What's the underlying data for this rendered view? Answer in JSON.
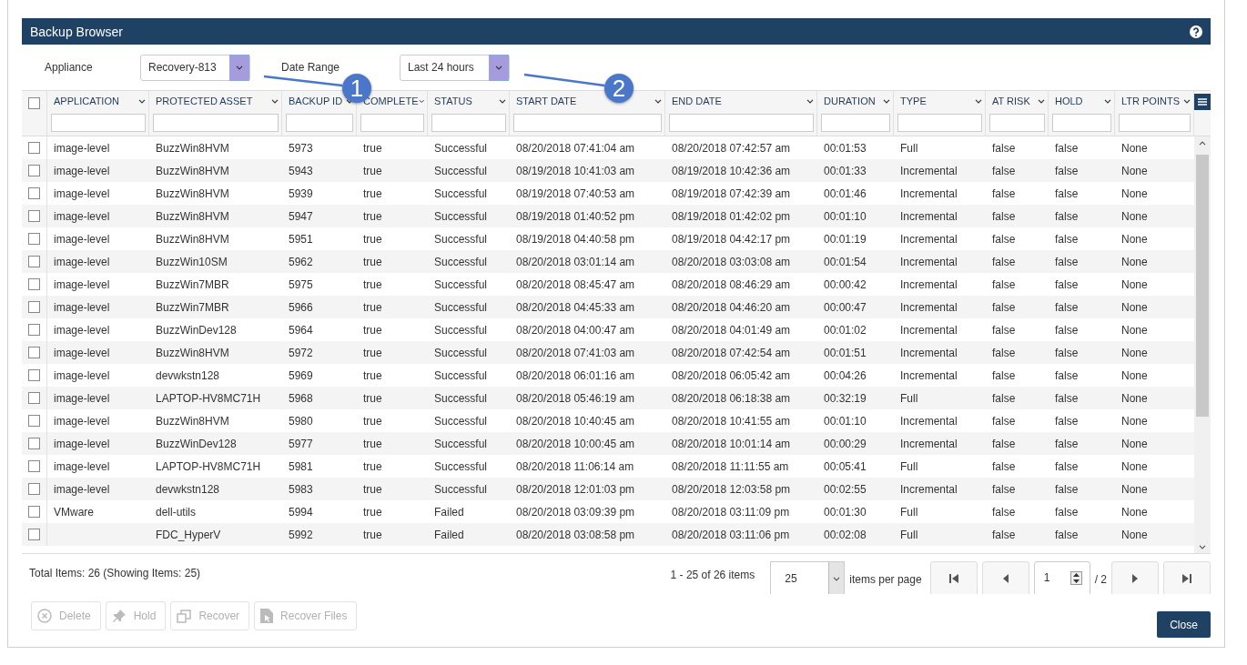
{
  "window": {
    "title": "Backup Browser"
  },
  "filters": [
    {
      "label": "Appliance",
      "value": "Recovery-813",
      "highlighted": true
    },
    {
      "label": "Date Range",
      "value": "Last 24 hours",
      "highlighted": true
    }
  ],
  "callouts": [
    "1",
    "2"
  ],
  "table": {
    "select_all": {
      "checked": false
    },
    "columns": [
      "APPLICATION",
      "PROTECTED ASSET",
      "BACKUP ID",
      "COMPLETE",
      "STATUS",
      "START DATE",
      "END DATE",
      "DURATION",
      "TYPE",
      "AT RISK",
      "HOLD",
      "LTR POINTS"
    ],
    "rows": [
      {
        "checked": false,
        "cells": [
          "image-level",
          "BuzzWin8HVM",
          "5973",
          "true",
          "Successful",
          "08/20/2018 07:41:04 am",
          "08/20/2018 07:42:57 am",
          "00:01:53",
          "Full",
          "false",
          "false",
          "None"
        ]
      },
      {
        "checked": false,
        "cells": [
          "image-level",
          "BuzzWin8HVM",
          "5943",
          "true",
          "Successful",
          "08/19/2018 10:41:03 am",
          "08/19/2018 10:42:36 am",
          "00:01:33",
          "Incremental",
          "false",
          "false",
          "None"
        ]
      },
      {
        "checked": false,
        "cells": [
          "image-level",
          "BuzzWin8HVM",
          "5939",
          "true",
          "Successful",
          "08/19/2018 07:40:53 am",
          "08/19/2018 07:42:39 am",
          "00:01:46",
          "Incremental",
          "false",
          "false",
          "None"
        ]
      },
      {
        "checked": false,
        "cells": [
          "image-level",
          "BuzzWin8HVM",
          "5947",
          "true",
          "Successful",
          "08/19/2018 01:40:52 pm",
          "08/19/2018 01:42:02 pm",
          "00:01:10",
          "Incremental",
          "false",
          "false",
          "None"
        ]
      },
      {
        "checked": false,
        "cells": [
          "image-level",
          "BuzzWin8HVM",
          "5951",
          "true",
          "Successful",
          "08/19/2018 04:40:58 pm",
          "08/19/2018 04:42:17 pm",
          "00:01:19",
          "Incremental",
          "false",
          "false",
          "None"
        ]
      },
      {
        "checked": false,
        "cells": [
          "image-level",
          "BuzzWin10SM",
          "5962",
          "true",
          "Successful",
          "08/20/2018 03:01:14 am",
          "08/20/2018 03:03:08 am",
          "00:01:54",
          "Incremental",
          "false",
          "false",
          "None"
        ]
      },
      {
        "checked": false,
        "cells": [
          "image-level",
          "BuzzWin7MBR",
          "5975",
          "true",
          "Successful",
          "08/20/2018 08:45:47 am",
          "08/20/2018 08:46:29 am",
          "00:00:42",
          "Incremental",
          "false",
          "false",
          "None"
        ]
      },
      {
        "checked": false,
        "cells": [
          "image-level",
          "BuzzWin7MBR",
          "5966",
          "true",
          "Successful",
          "08/20/2018 04:45:33 am",
          "08/20/2018 04:46:20 am",
          "00:00:47",
          "Incremental",
          "false",
          "false",
          "None"
        ]
      },
      {
        "checked": false,
        "cells": [
          "image-level",
          "BuzzWinDev128",
          "5964",
          "true",
          "Successful",
          "08/20/2018 04:00:47 am",
          "08/20/2018 04:01:49 am",
          "00:01:02",
          "Incremental",
          "false",
          "false",
          "None"
        ]
      },
      {
        "checked": false,
        "cells": [
          "image-level",
          "BuzzWin8HVM",
          "5972",
          "true",
          "Successful",
          "08/20/2018 07:41:03 am",
          "08/20/2018 07:42:54 am",
          "00:01:51",
          "Incremental",
          "false",
          "false",
          "None"
        ]
      },
      {
        "checked": false,
        "cells": [
          "image-level",
          "devwkstn128",
          "5969",
          "true",
          "Successful",
          "08/20/2018 06:01:16 am",
          "08/20/2018 06:05:42 am",
          "00:04:26",
          "Incremental",
          "false",
          "false",
          "None"
        ]
      },
      {
        "checked": false,
        "cells": [
          "image-level",
          "LAPTOP-HV8MC71H",
          "5968",
          "true",
          "Successful",
          "08/20/2018 05:46:19 am",
          "08/20/2018 06:18:38 am",
          "00:32:19",
          "Full",
          "false",
          "false",
          "None"
        ]
      },
      {
        "checked": false,
        "cells": [
          "image-level",
          "BuzzWin8HVM",
          "5980",
          "true",
          "Successful",
          "08/20/2018 10:40:45 am",
          "08/20/2018 10:41:55 am",
          "00:01:10",
          "Incremental",
          "false",
          "false",
          "None"
        ]
      },
      {
        "checked": false,
        "cells": [
          "image-level",
          "BuzzWinDev128",
          "5977",
          "true",
          "Successful",
          "08/20/2018 10:00:45 am",
          "08/20/2018 10:01:14 am",
          "00:00:29",
          "Incremental",
          "false",
          "false",
          "None"
        ]
      },
      {
        "checked": false,
        "cells": [
          "image-level",
          "LAPTOP-HV8MC71H",
          "5981",
          "true",
          "Successful",
          "08/20/2018 11:06:14 am",
          "08/20/2018 11:11:55 am",
          "00:05:41",
          "Full",
          "false",
          "false",
          "None"
        ]
      },
      {
        "checked": false,
        "cells": [
          "image-level",
          "devwkstn128",
          "5983",
          "true",
          "Successful",
          "08/20/2018 12:01:03 pm",
          "08/20/2018 12:03:58 pm",
          "00:02:55",
          "Incremental",
          "false",
          "false",
          "None"
        ]
      },
      {
        "checked": false,
        "cells": [
          "VMware",
          "dell-utils",
          "5994",
          "true",
          "Failed",
          "08/20/2018 03:09:39 pm",
          "08/20/2018 03:11:09 pm",
          "00:01:30",
          "Full",
          "false",
          "false",
          "None"
        ]
      },
      {
        "checked": false,
        "cells": [
          "",
          "FDC_HyperV",
          "5992",
          "true",
          "Failed",
          "08/20/2018 03:08:58 pm",
          "08/20/2018 03:11:06 pm",
          "00:02:08",
          "Full",
          "false",
          "false",
          "None"
        ]
      }
    ]
  },
  "summary": "Total Items: 26 (Showing Items: 25)",
  "pager": {
    "range": "1 - 25 of 26 items",
    "page_size": "25",
    "page_size_label": "items per page",
    "page": "1",
    "of_pages": "/ 2"
  },
  "actions": [
    {
      "kind": "delete",
      "label": "Delete",
      "disabled": true
    },
    {
      "kind": "hold",
      "label": "Hold",
      "disabled": true
    },
    {
      "kind": "recover",
      "label": "Recover",
      "disabled": true
    },
    {
      "kind": "files",
      "label": "Recover Files",
      "disabled": true
    }
  ],
  "close": "Close"
}
